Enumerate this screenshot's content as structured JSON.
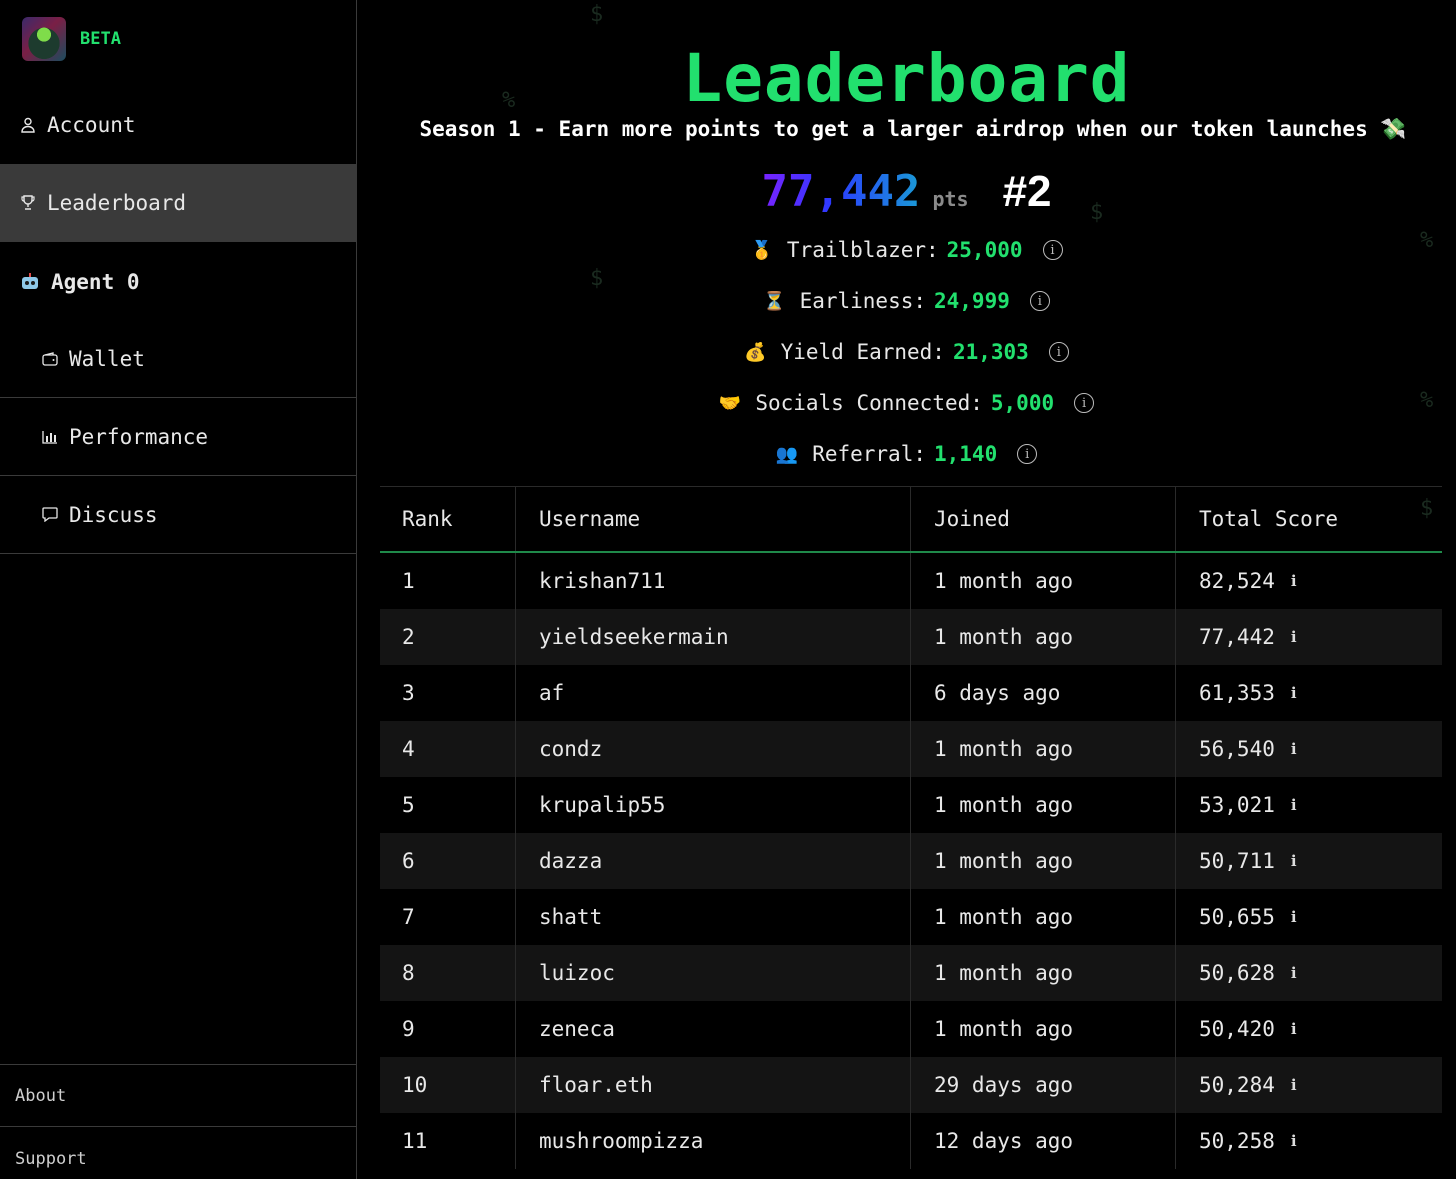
{
  "sidebar": {
    "badge": "BETA",
    "items": [
      {
        "label": "Account",
        "icon": "user-icon"
      },
      {
        "label": "Leaderboard",
        "icon": "trophy-icon",
        "active": true
      },
      {
        "label": "Agent 0",
        "icon": "robot-icon"
      },
      {
        "label": "Wallet",
        "icon": "wallet-icon"
      },
      {
        "label": "Performance",
        "icon": "bar-chart-icon"
      },
      {
        "label": "Discuss",
        "icon": "chat-icon"
      }
    ],
    "footer": {
      "about": "About",
      "support": "Support"
    }
  },
  "header": {
    "title": "Leaderboard",
    "subtitle": "Season 1 - Earn more points to get a larger airdrop when our token launches 💸"
  },
  "score": {
    "points": "77,442",
    "unit": "pts",
    "rank": "#2"
  },
  "stats": [
    {
      "emoji": "🥇",
      "label": "Trailblazer:",
      "value": "25,000"
    },
    {
      "emoji": "⏳",
      "label": "Earliness:",
      "value": "24,999"
    },
    {
      "emoji": "💰",
      "label": "Yield Earned:",
      "value": "21,303"
    },
    {
      "emoji": "🤝",
      "label": "Socials Connected:",
      "value": "5,000"
    },
    {
      "emoji": "👥",
      "label": "Referral:",
      "value": "1,140"
    }
  ],
  "table": {
    "columns": [
      "Rank",
      "Username",
      "Joined",
      "Total Score"
    ],
    "rows": [
      {
        "rank": "1",
        "username": "krishan711",
        "joined": "1 month ago",
        "score": "82,524"
      },
      {
        "rank": "2",
        "username": "yieldseekermain",
        "joined": "1 month ago",
        "score": "77,442"
      },
      {
        "rank": "3",
        "username": "af",
        "joined": "6 days ago",
        "score": "61,353"
      },
      {
        "rank": "4",
        "username": "condz",
        "joined": "1 month ago",
        "score": "56,540"
      },
      {
        "rank": "5",
        "username": "krupalip55",
        "joined": "1 month ago",
        "score": "53,021"
      },
      {
        "rank": "6",
        "username": "dazza",
        "joined": "1 month ago",
        "score": "50,711"
      },
      {
        "rank": "7",
        "username": "shatt",
        "joined": "1 month ago",
        "score": "50,655"
      },
      {
        "rank": "8",
        "username": "luizoc",
        "joined": "1 month ago",
        "score": "50,628"
      },
      {
        "rank": "9",
        "username": "zeneca",
        "joined": "1 month ago",
        "score": "50,420"
      },
      {
        "rank": "10",
        "username": "floar.eth",
        "joined": "29 days ago",
        "score": "50,284"
      },
      {
        "rank": "11",
        "username": "mushroompizza",
        "joined": "12 days ago",
        "score": "50,258"
      }
    ]
  },
  "colors": {
    "accent": "#22e06e",
    "background": "#000000",
    "active_nav": "#3a3a3a"
  }
}
